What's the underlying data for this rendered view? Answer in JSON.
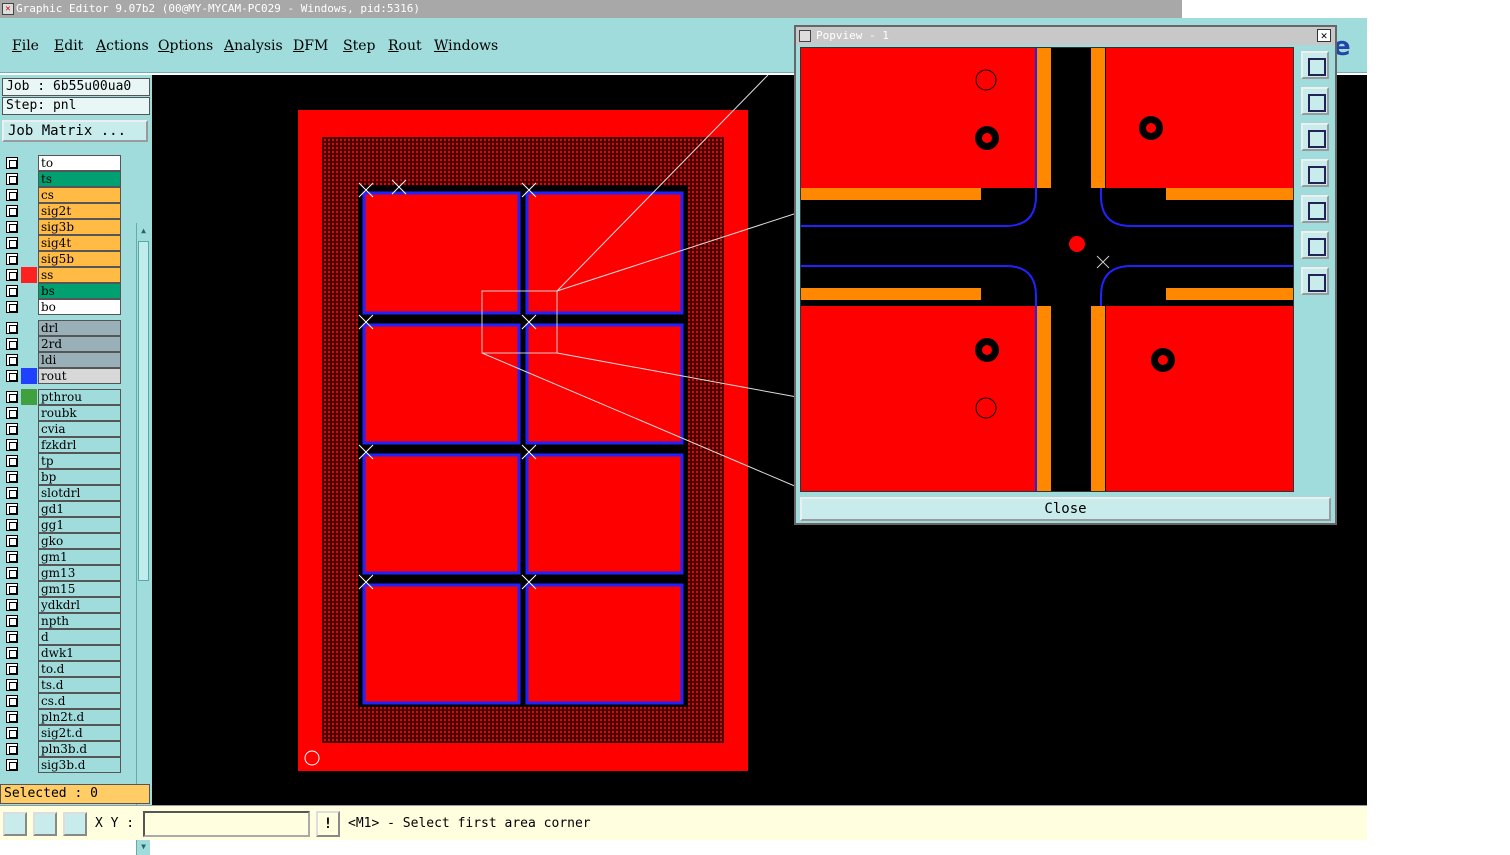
{
  "window": {
    "title": "Graphic Editor 9.07b2 (00@MY-MYCAM-PC029 - Windows, pid:5316)"
  },
  "menu": [
    {
      "key": "F",
      "rest": "ile"
    },
    {
      "key": "E",
      "rest": "dit"
    },
    {
      "key": "A",
      "rest": "ctions"
    },
    {
      "key": "O",
      "rest": "ptions"
    },
    {
      "key": "A",
      "rest": "nalysis"
    },
    {
      "key": "D",
      "rest": "FM"
    },
    {
      "key": "S",
      "rest": "tep"
    },
    {
      "key": "R",
      "rest": "out"
    },
    {
      "key": "W",
      "rest": "indows"
    }
  ],
  "brand_fragment": "e",
  "job": {
    "job_label": "Job : 6b55u00ua0",
    "step_label": "Step: pnl",
    "matrix_button": "Job Matrix ..."
  },
  "layers": [
    {
      "name": "to",
      "color": "#ffffff"
    },
    {
      "name": "ts",
      "color": "#00a070"
    },
    {
      "name": "cs",
      "color": "#ffbb44"
    },
    {
      "name": "sig2t",
      "color": "#ffbb44"
    },
    {
      "name": "sig3b",
      "color": "#ffbb44"
    },
    {
      "name": "sig4t",
      "color": "#ffbb44"
    },
    {
      "name": "sig5b",
      "color": "#ffbb44"
    },
    {
      "name": "ss",
      "color": "#ffbb44",
      "swatch": "#ff2020",
      "active": true
    },
    {
      "name": "bs",
      "color": "#00a070"
    },
    {
      "name": "bo",
      "color": "#ffffff"
    },
    {
      "name": "drl",
      "color": "#9ab0b8"
    },
    {
      "name": "2rd",
      "color": "#9ab0b8"
    },
    {
      "name": "ldi",
      "color": "#9ab0b8"
    },
    {
      "name": "rout",
      "color": "#d8d8d8",
      "swatch": "#2040ff"
    },
    {
      "name": "pthrou",
      "color": "#a0dcdc",
      "swatch": "#40a040"
    },
    {
      "name": "roubk",
      "color": "#a0dcdc"
    },
    {
      "name": "cvia",
      "color": "#a0dcdc"
    },
    {
      "name": "fzkdrl",
      "color": "#a0dcdc"
    },
    {
      "name": "tp",
      "color": "#a0dcdc"
    },
    {
      "name": "bp",
      "color": "#a0dcdc"
    },
    {
      "name": "slotdrl",
      "color": "#a0dcdc"
    },
    {
      "name": "gd1",
      "color": "#a0dcdc"
    },
    {
      "name": "gg1",
      "color": "#a0dcdc"
    },
    {
      "name": "gko",
      "color": "#a0dcdc"
    },
    {
      "name": "gm1",
      "color": "#a0dcdc"
    },
    {
      "name": "gm13",
      "color": "#a0dcdc"
    },
    {
      "name": "gm15",
      "color": "#a0dcdc"
    },
    {
      "name": "ydkdrl",
      "color": "#a0dcdc"
    },
    {
      "name": "npth",
      "color": "#a0dcdc"
    },
    {
      "name": "d",
      "color": "#a0dcdc"
    },
    {
      "name": "dwk1",
      "color": "#a0dcdc"
    },
    {
      "name": "to.d",
      "color": "#a0dcdc"
    },
    {
      "name": "ts.d",
      "color": "#a0dcdc"
    },
    {
      "name": "cs.d",
      "color": "#a0dcdc"
    },
    {
      "name": "pln2t.d",
      "color": "#a0dcdc"
    },
    {
      "name": "sig2t.d",
      "color": "#a0dcdc"
    },
    {
      "name": "pln3b.d",
      "color": "#a0dcdc"
    },
    {
      "name": "sig3b.d",
      "color": "#a0dcdc"
    }
  ],
  "selected_label": "Selected : 0",
  "status": {
    "xy_label": "X Y :",
    "xy_value": "",
    "warn": "!",
    "prompt": "<M1> - Select first area corner"
  },
  "popview": {
    "title": "Popview - 1",
    "close_x": "✕",
    "close_button": "Close"
  },
  "colors": {
    "copper": "#ff0000",
    "rout": "#2030ff",
    "background": "#000000",
    "panel": "#a0dcdc"
  }
}
